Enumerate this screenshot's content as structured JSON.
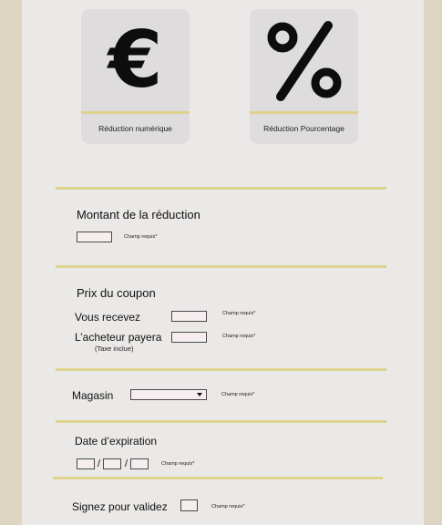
{
  "discount_types": [
    {
      "label": "Réduction numérique",
      "icon": "euro-icon",
      "glyph": "€"
    },
    {
      "label": "Réduction Pourcentage",
      "icon": "percent-icon",
      "glyph": "%"
    }
  ],
  "amount_section": {
    "heading": "Montant de la réduction",
    "required": "Champ requis*"
  },
  "price_section": {
    "heading": "Prix du coupon",
    "you_receive_label": "Vous recevez",
    "you_receive_required": "Champ requis*",
    "buyer_pays_label": "L’acheteur payera",
    "buyer_pays_note": "(Taxe inclue)",
    "buyer_pays_required": "Champ requis*"
  },
  "store_section": {
    "label": "Magasin",
    "required": "Champ requis*"
  },
  "expiry_section": {
    "heading": "Date d’expiration",
    "separator": "/",
    "required": "Champ requis*"
  },
  "sign_section": {
    "label": "Signez pour validez",
    "required": "Champ requis*"
  },
  "colors": {
    "background": "#ddd5c2",
    "panel": "#ebe9e7",
    "accent": "#ddd38f",
    "card": "#dedcdc",
    "field": "#f6eeee"
  }
}
